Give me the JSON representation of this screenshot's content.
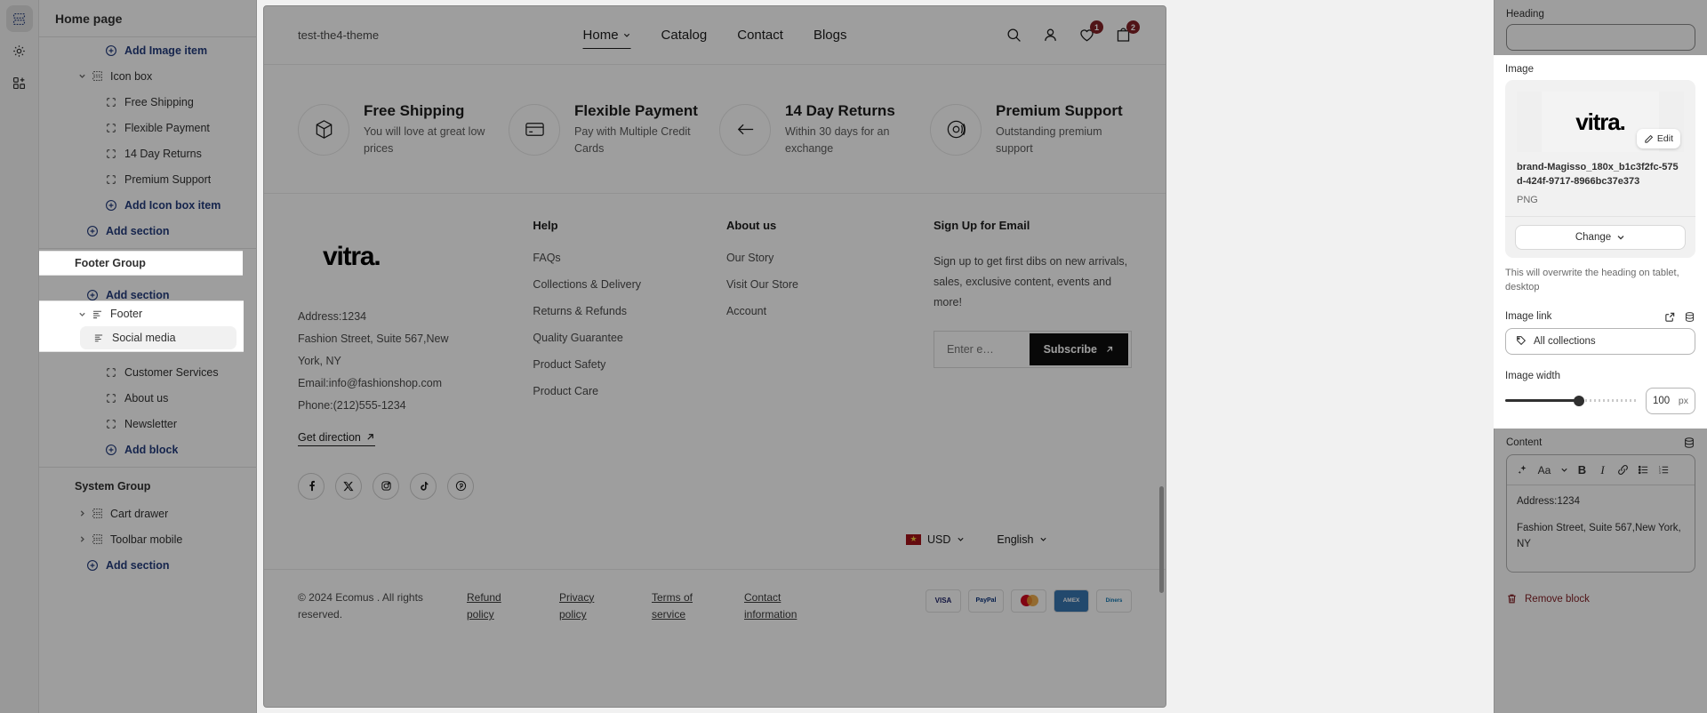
{
  "rail": {
    "items": [
      {
        "name": "sections-icon",
        "label": "Sections"
      },
      {
        "name": "settings-gear-icon",
        "label": "Theme settings"
      },
      {
        "name": "apps-add-icon",
        "label": "Apps"
      }
    ]
  },
  "sidebar": {
    "title": "Home page",
    "rows": [
      {
        "label": "Add Image item",
        "kind": "link",
        "indent": 2,
        "icon": "plus-circle-icon"
      },
      {
        "label": "Icon box",
        "kind": "section",
        "indent": 1,
        "icon": "section-icon",
        "caret": "down"
      },
      {
        "label": "Free Shipping",
        "kind": "block",
        "indent": 3,
        "icon": "block-icon"
      },
      {
        "label": "Flexible Payment",
        "kind": "block",
        "indent": 3,
        "icon": "block-icon"
      },
      {
        "label": "14 Day Returns",
        "kind": "block",
        "indent": 3,
        "icon": "block-icon"
      },
      {
        "label": "Premium Support",
        "kind": "block",
        "indent": 3,
        "icon": "block-icon"
      },
      {
        "label": "Add Icon box item",
        "kind": "link",
        "indent": 2,
        "icon": "plus-circle-icon"
      },
      {
        "label": "Add section",
        "kind": "link",
        "indent": 1,
        "icon": "plus-circle-icon"
      }
    ],
    "footer_group_title": "Footer Group",
    "footer_group_add": "Add section",
    "footer_section": "Footer",
    "footer_blocks": [
      {
        "label": "Social media",
        "selected": true,
        "icon": "text-block-icon"
      },
      {
        "label": "Customer Services",
        "selected": false,
        "icon": "block-icon"
      },
      {
        "label": "About us",
        "selected": false,
        "icon": "block-icon"
      },
      {
        "label": "Newsletter",
        "selected": false,
        "icon": "block-icon"
      }
    ],
    "add_block": "Add block",
    "system_group_title": "System Group",
    "system_rows": [
      {
        "label": "Cart drawer",
        "icon": "section-icon",
        "caret": "right"
      },
      {
        "label": "Toolbar mobile",
        "icon": "section-icon",
        "caret": "right"
      }
    ],
    "system_add": "Add section"
  },
  "preview": {
    "brand": "test-the4-theme",
    "nav": [
      {
        "label": "Home",
        "active": true,
        "caret": true
      },
      {
        "label": "Catalog",
        "active": false,
        "caret": false
      },
      {
        "label": "Contact",
        "active": false,
        "caret": false
      },
      {
        "label": "Blogs",
        "active": false,
        "caret": false
      }
    ],
    "header_icons": [
      {
        "name": "search-icon",
        "badge": ""
      },
      {
        "name": "account-icon",
        "badge": ""
      },
      {
        "name": "wishlist-heart-icon",
        "badge": "1"
      },
      {
        "name": "cart-bag-icon",
        "badge": "2"
      }
    ],
    "features": [
      {
        "icon": "box-icon",
        "title": "Free Shipping",
        "sub": "You will love at great low prices"
      },
      {
        "icon": "card-icon",
        "title": "Flexible Payment",
        "sub": "Pay with Multiple Credit Cards"
      },
      {
        "icon": "return-arrow-icon",
        "title": "14 Day Returns",
        "sub": "Within 30 days for an exchange"
      },
      {
        "icon": "support-headset-icon",
        "title": "Premium Support",
        "sub": "Outstanding premium support"
      }
    ],
    "logo_text": "vitra.",
    "address_lines": [
      "Address:1234",
      "Fashion Street, Suite 567,New York, NY",
      "Email:info@fashionshop.com",
      "Phone:(212)555-1234"
    ],
    "get_direction": "Get direction",
    "socials": [
      {
        "name": "facebook-icon",
        "glyph": "f"
      },
      {
        "name": "x-twitter-icon",
        "glyph": "×"
      },
      {
        "name": "instagram-icon",
        "glyph": "□"
      },
      {
        "name": "tiktok-icon",
        "glyph": "♪"
      },
      {
        "name": "pinterest-icon",
        "glyph": "Ⓟ"
      }
    ],
    "columns": [
      {
        "title": "Help",
        "links": [
          "FAQs",
          "Collections & Delivery",
          "Returns & Refunds",
          "Quality Guarantee",
          "Product Safety",
          "Product Care"
        ]
      },
      {
        "title": "About us",
        "links": [
          "Our Story",
          "Visit Our Store",
          "Account"
        ]
      }
    ],
    "newsletter": {
      "title": "Sign Up for Email",
      "text": "Sign up to get first dibs on new arrivals, sales, exclusive content, events and more!",
      "placeholder": "Enter e…",
      "button": "Subscribe"
    },
    "currency": "USD",
    "language": "English",
    "copyright": "© 2024 Ecomus . All rights reserved.",
    "policies": [
      "Refund policy",
      "Privacy policy",
      "Terms of service",
      "Contact information"
    ],
    "payments": [
      "VISA",
      "PayPal",
      "MC",
      "AMEX",
      "Diners"
    ]
  },
  "rightpanel": {
    "heading_label": "Heading",
    "heading_value": "",
    "image_label": "Image",
    "image_logo_text": "vitra.",
    "edit_label": "Edit",
    "image_filename": "brand-Magisso_180x_b1c3f2fc-575d-424f-9717-8966bc37e373",
    "image_type": "PNG",
    "change_label": "Change",
    "helper_text": "This will overwrite the heading on tablet, desktop",
    "image_link_label": "Image link",
    "image_link_value": "All collections",
    "image_width_label": "Image width",
    "image_width_value": "100",
    "image_width_unit": "px",
    "content_label": "Content",
    "content_lines": [
      "Address:1234",
      "Fashion Street, Suite 567,New York, NY"
    ],
    "remove_block_label": "Remove block",
    "rte_buttons": [
      {
        "name": "ai-sparkle-icon",
        "glyph": "✦"
      },
      {
        "name": "font-size-icon",
        "glyph": "Aa"
      },
      {
        "name": "chevron-down-icon",
        "glyph": "⌄"
      },
      {
        "name": "bold-icon",
        "glyph": "B"
      },
      {
        "name": "italic-icon",
        "glyph": "I"
      },
      {
        "name": "link-icon",
        "glyph": "🔗"
      },
      {
        "name": "bullet-list-icon",
        "glyph": "☰"
      },
      {
        "name": "numbered-list-icon",
        "glyph": "≡"
      }
    ]
  },
  "colors": {
    "accent_blue": "#1f3c88",
    "danger_red": "#8f1c23",
    "text_primary": "#303030"
  }
}
